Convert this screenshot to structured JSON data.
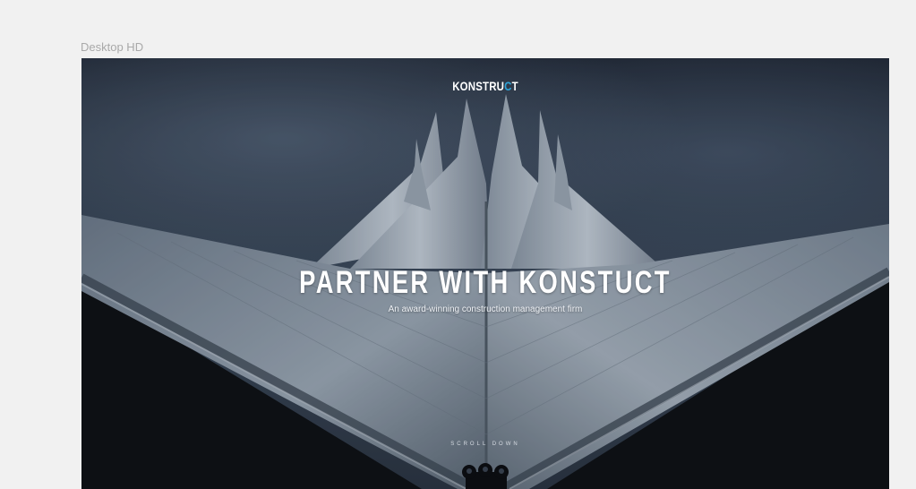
{
  "artboard": {
    "label": "Desktop HD"
  },
  "hero": {
    "logo_main": "KONSTRU",
    "logo_accent": "C",
    "logo_end": "T",
    "headline": "PARTNER WITH KONSTUCT",
    "subheadline": "An award-winning construction management firm",
    "scroll_label": "SCROLL DOWN"
  },
  "colors": {
    "accent": "#2ea3d8",
    "canvas": "#f1f1f1",
    "text": "#ffffff"
  }
}
